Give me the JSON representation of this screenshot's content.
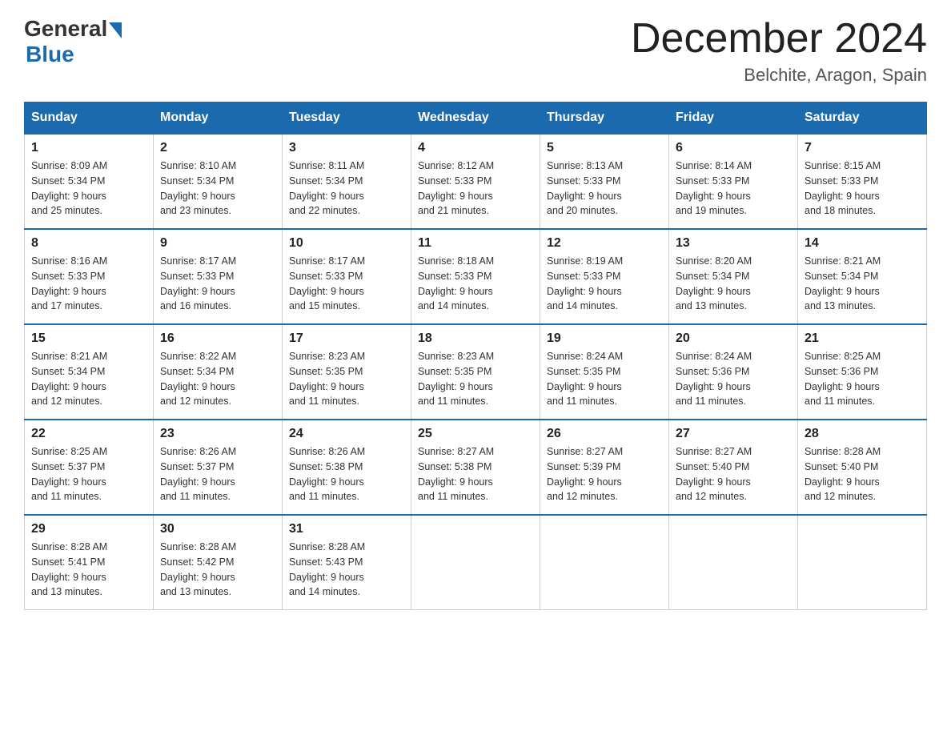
{
  "header": {
    "logo_general": "General",
    "logo_blue": "Blue",
    "month_title": "December 2024",
    "location": "Belchite, Aragon, Spain"
  },
  "weekdays": [
    "Sunday",
    "Monday",
    "Tuesday",
    "Wednesday",
    "Thursday",
    "Friday",
    "Saturday"
  ],
  "weeks": [
    [
      {
        "day": "1",
        "sunrise": "8:09 AM",
        "sunset": "5:34 PM",
        "daylight": "9 hours and 25 minutes."
      },
      {
        "day": "2",
        "sunrise": "8:10 AM",
        "sunset": "5:34 PM",
        "daylight": "9 hours and 23 minutes."
      },
      {
        "day": "3",
        "sunrise": "8:11 AM",
        "sunset": "5:34 PM",
        "daylight": "9 hours and 22 minutes."
      },
      {
        "day": "4",
        "sunrise": "8:12 AM",
        "sunset": "5:33 PM",
        "daylight": "9 hours and 21 minutes."
      },
      {
        "day": "5",
        "sunrise": "8:13 AM",
        "sunset": "5:33 PM",
        "daylight": "9 hours and 20 minutes."
      },
      {
        "day": "6",
        "sunrise": "8:14 AM",
        "sunset": "5:33 PM",
        "daylight": "9 hours and 19 minutes."
      },
      {
        "day": "7",
        "sunrise": "8:15 AM",
        "sunset": "5:33 PM",
        "daylight": "9 hours and 18 minutes."
      }
    ],
    [
      {
        "day": "8",
        "sunrise": "8:16 AM",
        "sunset": "5:33 PM",
        "daylight": "9 hours and 17 minutes."
      },
      {
        "day": "9",
        "sunrise": "8:17 AM",
        "sunset": "5:33 PM",
        "daylight": "9 hours and 16 minutes."
      },
      {
        "day": "10",
        "sunrise": "8:17 AM",
        "sunset": "5:33 PM",
        "daylight": "9 hours and 15 minutes."
      },
      {
        "day": "11",
        "sunrise": "8:18 AM",
        "sunset": "5:33 PM",
        "daylight": "9 hours and 14 minutes."
      },
      {
        "day": "12",
        "sunrise": "8:19 AM",
        "sunset": "5:33 PM",
        "daylight": "9 hours and 14 minutes."
      },
      {
        "day": "13",
        "sunrise": "8:20 AM",
        "sunset": "5:34 PM",
        "daylight": "9 hours and 13 minutes."
      },
      {
        "day": "14",
        "sunrise": "8:21 AM",
        "sunset": "5:34 PM",
        "daylight": "9 hours and 13 minutes."
      }
    ],
    [
      {
        "day": "15",
        "sunrise": "8:21 AM",
        "sunset": "5:34 PM",
        "daylight": "9 hours and 12 minutes."
      },
      {
        "day": "16",
        "sunrise": "8:22 AM",
        "sunset": "5:34 PM",
        "daylight": "9 hours and 12 minutes."
      },
      {
        "day": "17",
        "sunrise": "8:23 AM",
        "sunset": "5:35 PM",
        "daylight": "9 hours and 11 minutes."
      },
      {
        "day": "18",
        "sunrise": "8:23 AM",
        "sunset": "5:35 PM",
        "daylight": "9 hours and 11 minutes."
      },
      {
        "day": "19",
        "sunrise": "8:24 AM",
        "sunset": "5:35 PM",
        "daylight": "9 hours and 11 minutes."
      },
      {
        "day": "20",
        "sunrise": "8:24 AM",
        "sunset": "5:36 PM",
        "daylight": "9 hours and 11 minutes."
      },
      {
        "day": "21",
        "sunrise": "8:25 AM",
        "sunset": "5:36 PM",
        "daylight": "9 hours and 11 minutes."
      }
    ],
    [
      {
        "day": "22",
        "sunrise": "8:25 AM",
        "sunset": "5:37 PM",
        "daylight": "9 hours and 11 minutes."
      },
      {
        "day": "23",
        "sunrise": "8:26 AM",
        "sunset": "5:37 PM",
        "daylight": "9 hours and 11 minutes."
      },
      {
        "day": "24",
        "sunrise": "8:26 AM",
        "sunset": "5:38 PM",
        "daylight": "9 hours and 11 minutes."
      },
      {
        "day": "25",
        "sunrise": "8:27 AM",
        "sunset": "5:38 PM",
        "daylight": "9 hours and 11 minutes."
      },
      {
        "day": "26",
        "sunrise": "8:27 AM",
        "sunset": "5:39 PM",
        "daylight": "9 hours and 12 minutes."
      },
      {
        "day": "27",
        "sunrise": "8:27 AM",
        "sunset": "5:40 PM",
        "daylight": "9 hours and 12 minutes."
      },
      {
        "day": "28",
        "sunrise": "8:28 AM",
        "sunset": "5:40 PM",
        "daylight": "9 hours and 12 minutes."
      }
    ],
    [
      {
        "day": "29",
        "sunrise": "8:28 AM",
        "sunset": "5:41 PM",
        "daylight": "9 hours and 13 minutes."
      },
      {
        "day": "30",
        "sunrise": "8:28 AM",
        "sunset": "5:42 PM",
        "daylight": "9 hours and 13 minutes."
      },
      {
        "day": "31",
        "sunrise": "8:28 AM",
        "sunset": "5:43 PM",
        "daylight": "9 hours and 14 minutes."
      },
      null,
      null,
      null,
      null
    ]
  ],
  "labels": {
    "sunrise": "Sunrise:",
    "sunset": "Sunset:",
    "daylight": "Daylight:"
  }
}
